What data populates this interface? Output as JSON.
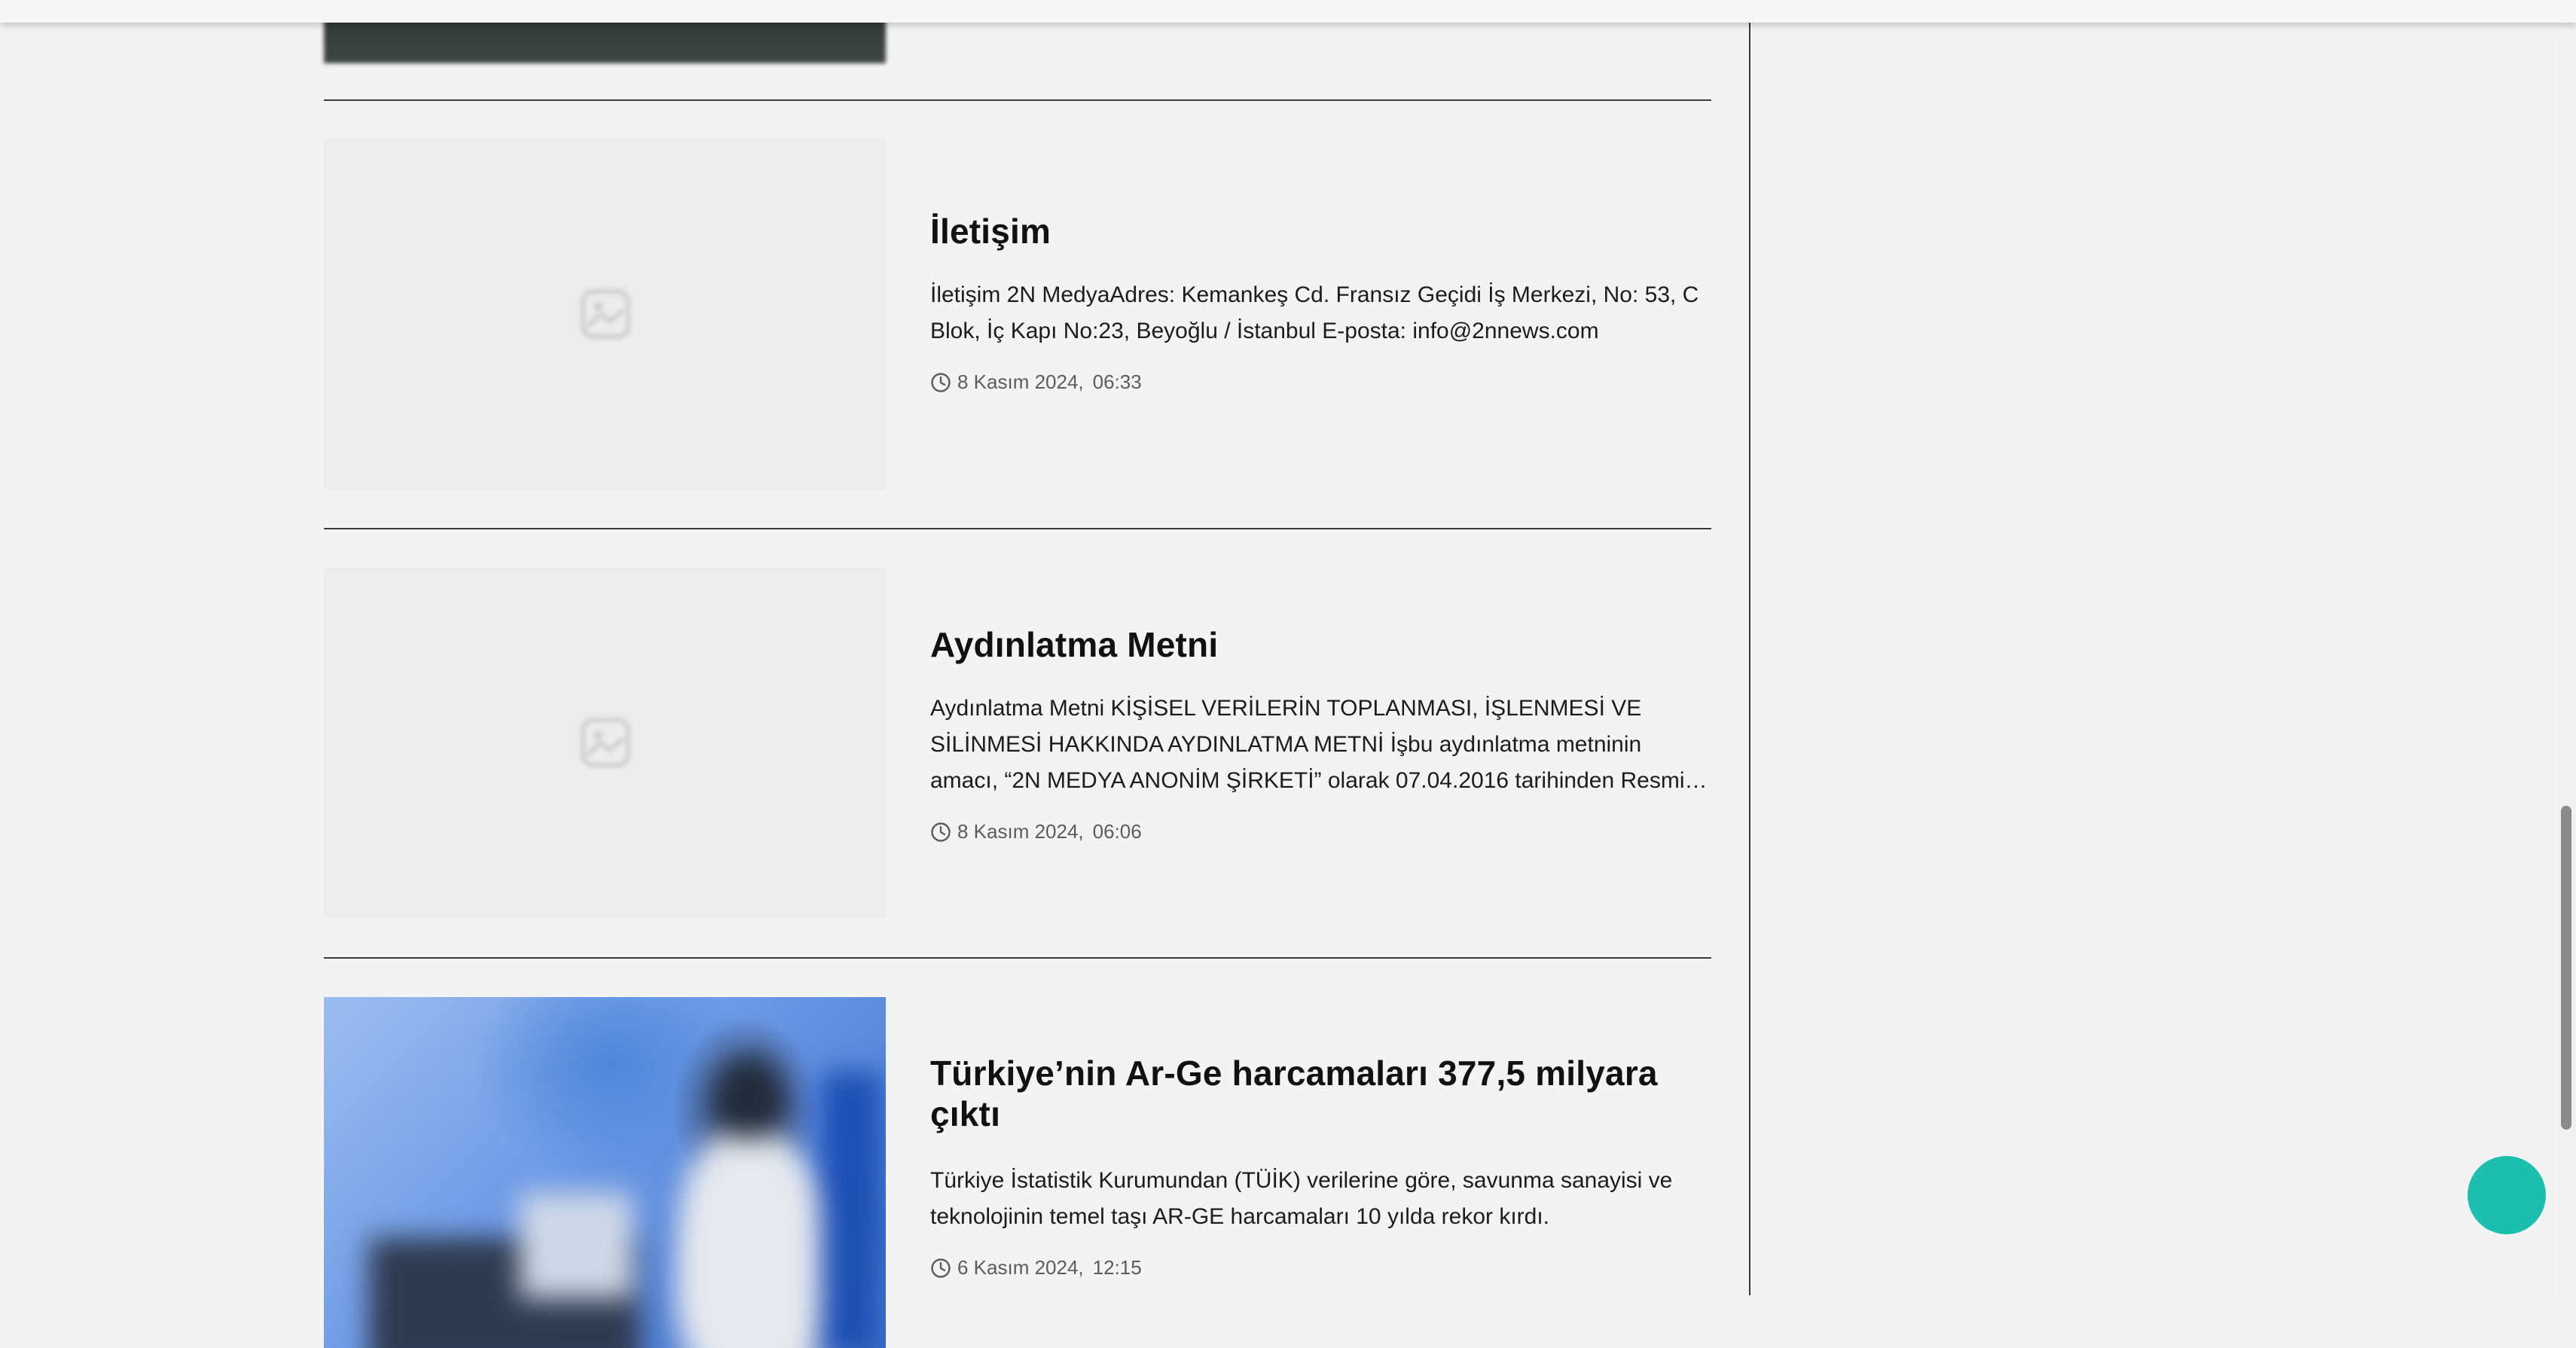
{
  "articles": [
    {
      "title": "İletişim",
      "excerpt": "İletişim 2N MedyaAdres: Kemankeş Cd. Fransız Geçidi İş Merkezi, No: 53, C Blok, İç Kapı No:23, Beyoğlu / İstanbul E-posta: info@2nnews.com",
      "date": "8 Kasım 2024,",
      "time": "06:33",
      "image": "placeholder-image-icon"
    },
    {
      "title": "Aydınlatma Metni",
      "excerpt": "Aydınlatma Metni KİŞİSEL VERİLERİN TOPLANMASI, İŞLENMESİ VE SİLİNMESİ HAKKINDA AYDINLATMA METNİ İşbu aydınlatma metninin amacı, “2N MEDYA ANONİM ŞİRKETİ” olarak 07.04.2016 tarihinden Resmi…",
      "date": "8 Kasım 2024,",
      "time": "06:06",
      "image": "placeholder-image-icon"
    },
    {
      "title": "Türkiye’nin Ar-Ge harcamaları 377,5 milyara çıktı",
      "excerpt": "Türkiye İstatistik Kurumundan (TÜİK) verilerine göre, savunma sanayisi ve teknolojinin temel taşı AR-GE harcamaları 10 yılda rekor kırdı.",
      "date": "6 Kasım 2024,",
      "time": "12:15",
      "image": "photo"
    }
  ],
  "icons": {
    "meta": "clock-icon",
    "placeholder": "image-placeholder-icon"
  },
  "colors": {
    "background": "#f3f3f3",
    "fab": "#1cbfae",
    "divider": "#3c3c3c",
    "meta_text": "#5c5c5c"
  }
}
